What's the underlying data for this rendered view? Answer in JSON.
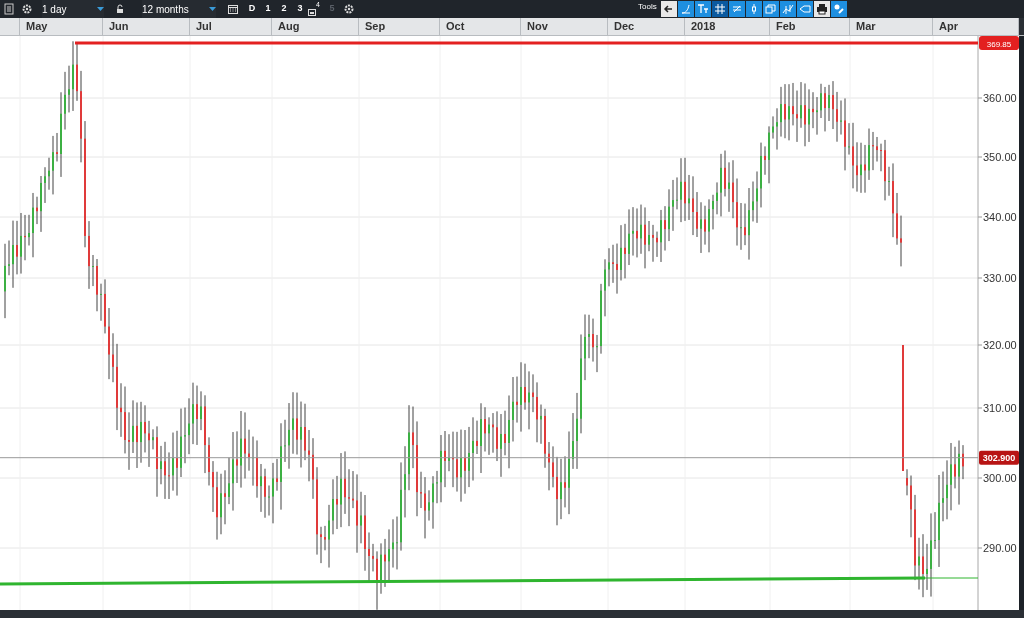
{
  "toolbar": {
    "interval": "1 day",
    "range": "12 months",
    "period_buttons": [
      {
        "label": "D",
        "disabled": false
      },
      {
        "label": "1",
        "disabled": false
      },
      {
        "label": "2",
        "disabled": false
      },
      {
        "label": "3",
        "disabled": false
      },
      {
        "label": "4",
        "disabled": false,
        "kind": "icon"
      },
      {
        "label": "5",
        "disabled": true
      }
    ],
    "tools_label": "Tools"
  },
  "months": [
    "May",
    "Jun",
    "Jul",
    "Aug",
    "Sep",
    "Oct",
    "Nov",
    "Dec",
    "2018",
    "Feb",
    "Mar",
    "Apr"
  ],
  "y_axis": [
    "360.00",
    "350.00",
    "340.00",
    "330.00",
    "320.00",
    "310.00",
    "300.00",
    "290.00"
  ],
  "price_tags": [
    {
      "label": "369.85",
      "kind": "resistance"
    },
    {
      "label": "302.900",
      "kind": "last"
    }
  ]
}
